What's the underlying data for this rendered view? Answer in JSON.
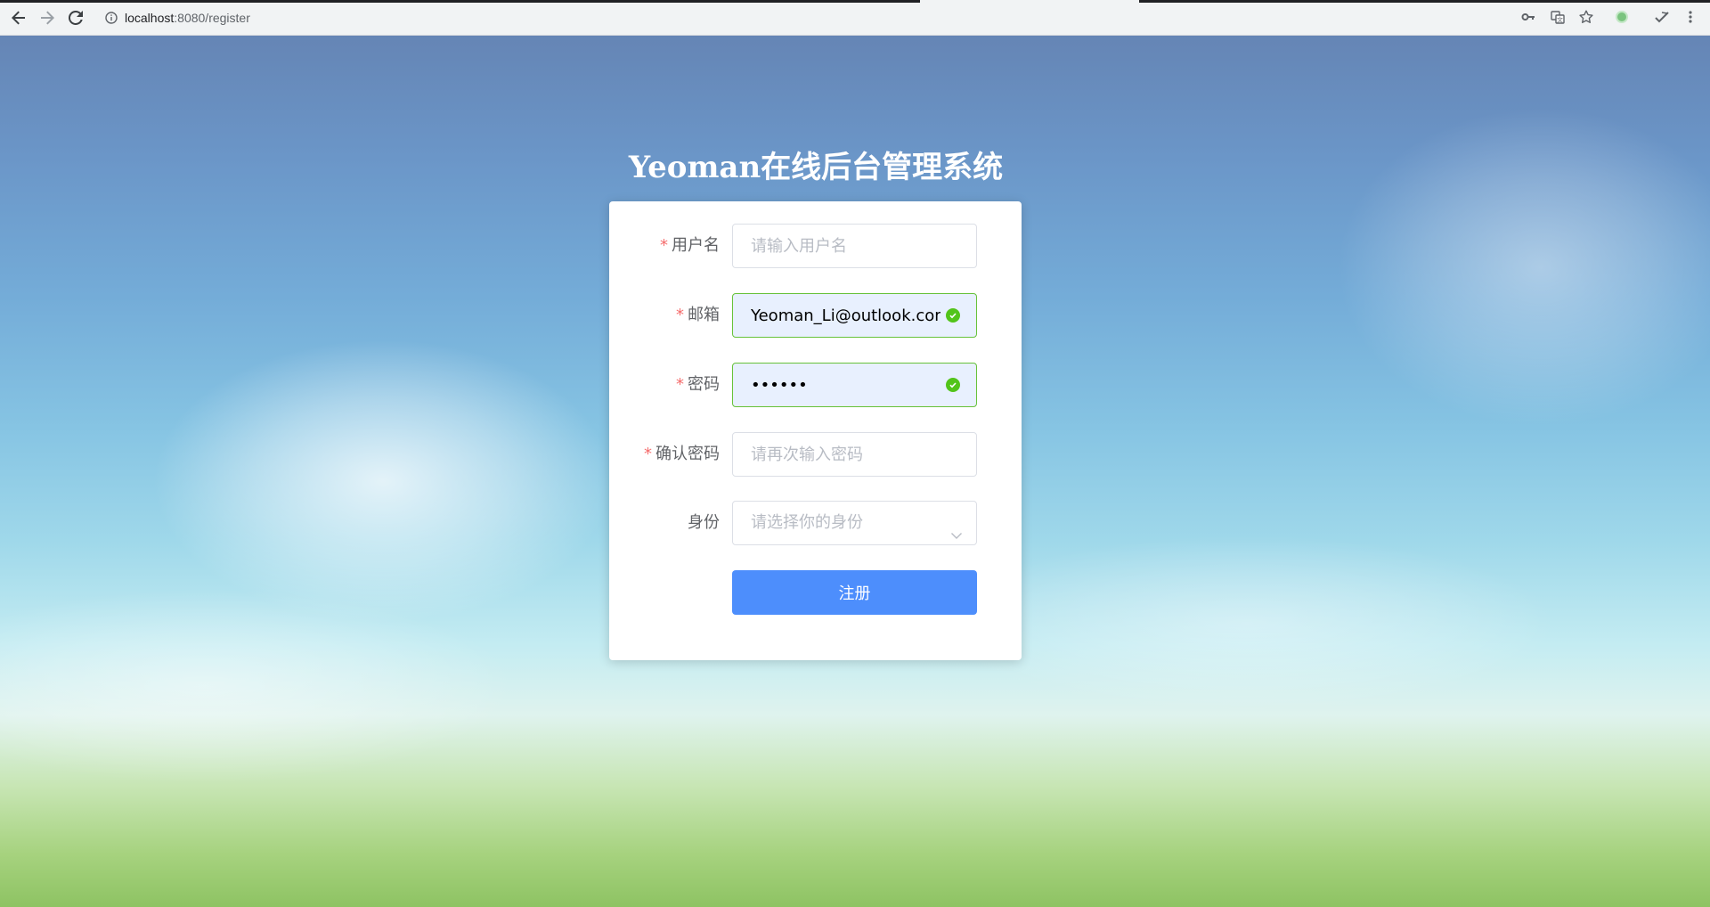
{
  "browser": {
    "url_host": "localhost",
    "url_rest": ":8080/register"
  },
  "page": {
    "title": "Yeoman在线后台管理系统"
  },
  "form": {
    "username": {
      "label": "用户名",
      "required": "*",
      "placeholder": "请输入用户名",
      "value": ""
    },
    "email": {
      "label": "邮箱",
      "required": "*",
      "placeholder": "",
      "value": "Yeoman_Li@outlook.com"
    },
    "password": {
      "label": "密码",
      "required": "*",
      "value": "••••••"
    },
    "confirm_password": {
      "label": "确认密码",
      "required": "*",
      "placeholder": "请再次输入密码",
      "value": ""
    },
    "role": {
      "label": "身份",
      "placeholder": "请选择你的身份"
    },
    "submit_label": "注册"
  },
  "colors": {
    "primary": "#4d8efc",
    "valid": "#52c41a",
    "required": "#f56c6c"
  }
}
